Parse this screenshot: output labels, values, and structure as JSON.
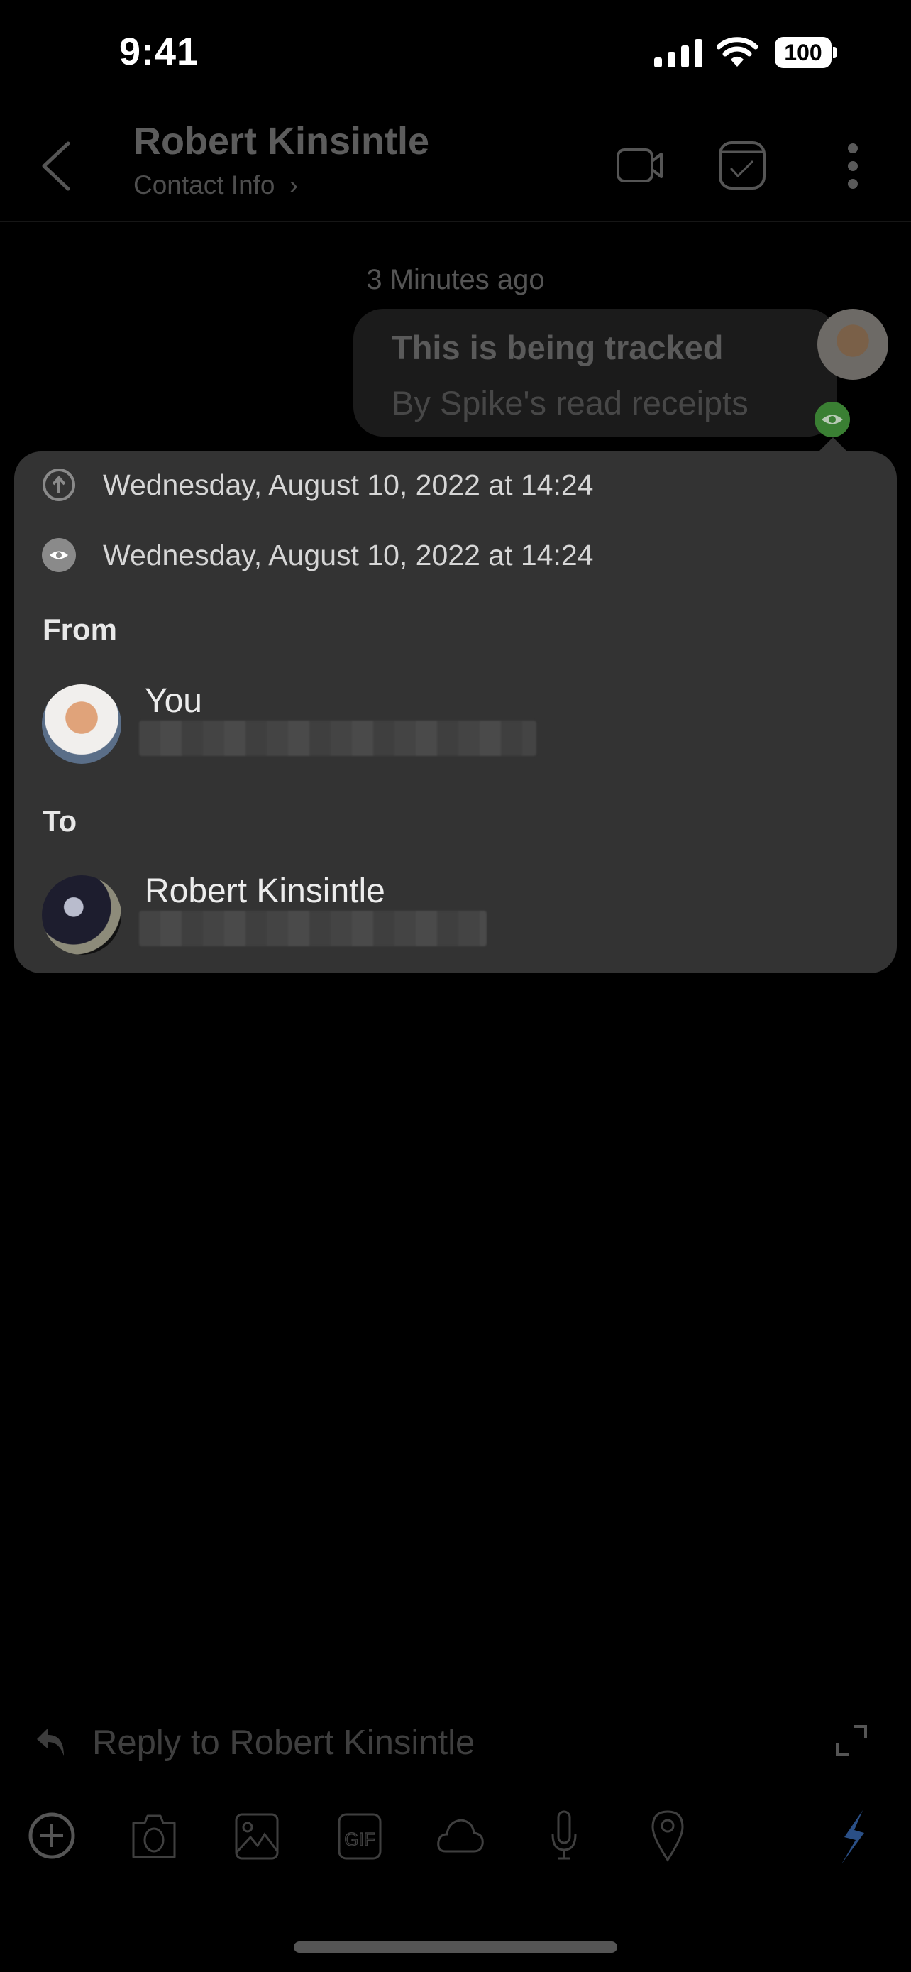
{
  "status_bar": {
    "time": "9:41",
    "battery": "100"
  },
  "header": {
    "title": "Robert Kinsintle",
    "subtitle": "Contact Info",
    "icons": [
      "back-chevron-icon",
      "video-call-icon",
      "task-icon",
      "more-vertical-icon"
    ]
  },
  "chat": {
    "timestamp": "3 Minutes ago",
    "message": {
      "line1": "This is being tracked",
      "line2": "By Spike's read receipts",
      "read_status_color": "#3a7f33"
    }
  },
  "receipt_popover": {
    "sent": {
      "icon": "sent-arrow-icon",
      "text": "Wednesday, August 10, 2022 at 14:24"
    },
    "read": {
      "icon": "read-eye-icon",
      "text": "Wednesday, August 10, 2022 at 14:24"
    },
    "from_label": "From",
    "from": {
      "name": "You",
      "email_redacted": true
    },
    "to_label": "To",
    "to": {
      "name": "Robert Kinsintle",
      "email_redacted": true
    }
  },
  "composer": {
    "placeholder": "Reply to Robert Kinsintle",
    "tools": [
      "add-icon",
      "camera-icon",
      "image-icon",
      "gif-icon",
      "cloud-icon",
      "microphone-icon",
      "location-icon",
      "send-bolt-icon"
    ],
    "send_color": "#2a4f86"
  }
}
